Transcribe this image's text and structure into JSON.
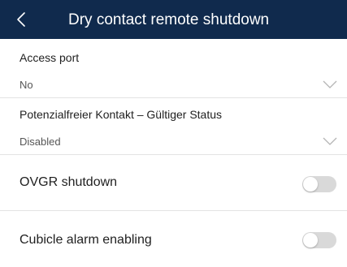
{
  "header": {
    "title": "Dry contact remote shutdown",
    "back_icon": "chevron-left-icon",
    "background": "#102a4d"
  },
  "access_port": {
    "label": "Access port",
    "value": "No",
    "icon": "chevron-down-icon"
  },
  "dry_contact_status": {
    "label": "Potenzialfreier Kontakt – Gültiger Status",
    "value": "Disabled",
    "icon": "chevron-down-icon"
  },
  "ovgr_shutdown": {
    "label": "OVGR shutdown",
    "enabled": false
  },
  "cubicle_alarm": {
    "label": "Cubicle alarm enabling",
    "enabled": false
  },
  "colors": {
    "toggle_off": "#d9d9d9",
    "divider": "#e3e3e3"
  }
}
